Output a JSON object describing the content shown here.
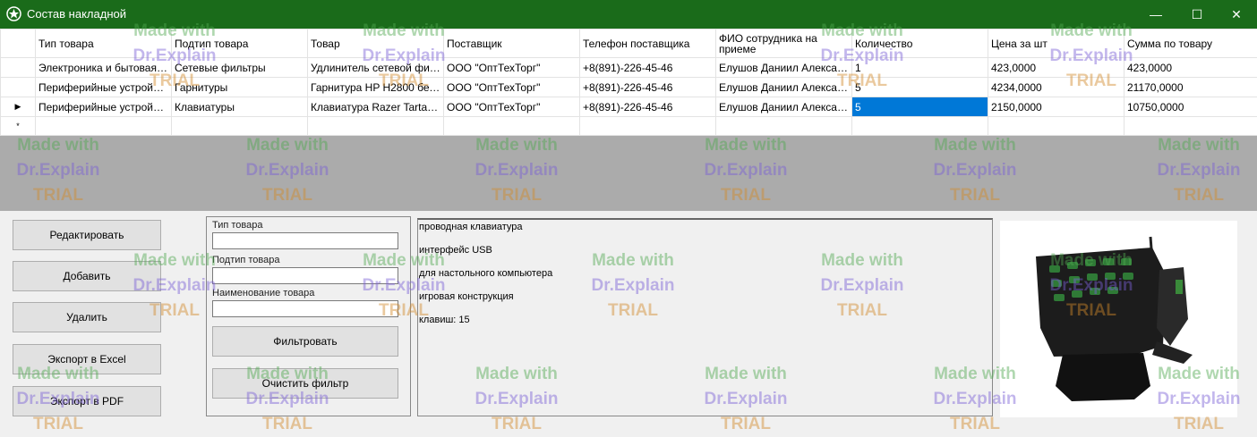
{
  "window": {
    "title": "Состав накладной",
    "minimize_icon": "—",
    "maximize_icon": "☐",
    "close_icon": "✕"
  },
  "grid": {
    "columns": [
      "Тип товара",
      "Подтип товара",
      "Товар",
      "Поставщик",
      "Телефон поставщика",
      "ФИО сотрудника на приеме",
      "Количество",
      "Цена за шт",
      "Сумма по товару"
    ],
    "rows": [
      {
        "marker": "",
        "cells": [
          "Электроника и бытовая те...",
          "Сетевые фильтры",
          "Удлинитель сетевой филь...",
          "ООО \"ОптТехТорг\"",
          "+8(891)-226-45-46",
          "Елушов Даниил Александ...",
          "1",
          "423,0000",
          "423,0000"
        ]
      },
      {
        "marker": "",
        "cells": [
          "Периферийные устройства",
          "Гарнитуры",
          "Гарнитура HP H2800 бель...",
          "ООО \"ОптТехТорг\"",
          "+8(891)-226-45-46",
          "Елушов Даниил Александ...",
          "5",
          "4234,0000",
          "21170,0000"
        ]
      },
      {
        "marker": "▶",
        "cells": [
          "Периферийные устройства",
          "Клавиатуры",
          "Клавиатура Razer Tartarus ...",
          "ООО \"ОптТехТорг\"",
          "+8(891)-226-45-46",
          "Елушов Даниил Александ...",
          "5",
          "2150,0000",
          "10750,0000"
        ]
      }
    ],
    "new_row_marker": "*"
  },
  "buttons": {
    "edit": "Редактировать",
    "add": "Добавить",
    "delete": "Удалить",
    "export_excel": "Экспорт в Excel",
    "export_pdf": "Экспорт в PDF"
  },
  "filter": {
    "type_label": "Тип товара",
    "type_value": "",
    "subtype_label": "Подтип товара",
    "subtype_value": "",
    "name_label": "Наименование товара",
    "name_value": "",
    "apply_button": "Фильтровать",
    "clear_button": "Очистить фильтр"
  },
  "description": {
    "lines": [
      "проводная клавиатура",
      "интерфейс USB",
      "для настольного компьютера",
      "игровая конструкция",
      "клавиш: 15"
    ]
  },
  "watermark": {
    "line1": "Made with",
    "line2": "Dr.Explain",
    "line3": "TRIAL"
  },
  "colors": {
    "titlebar": "#1a6b1a",
    "selection": "#0078d7"
  }
}
